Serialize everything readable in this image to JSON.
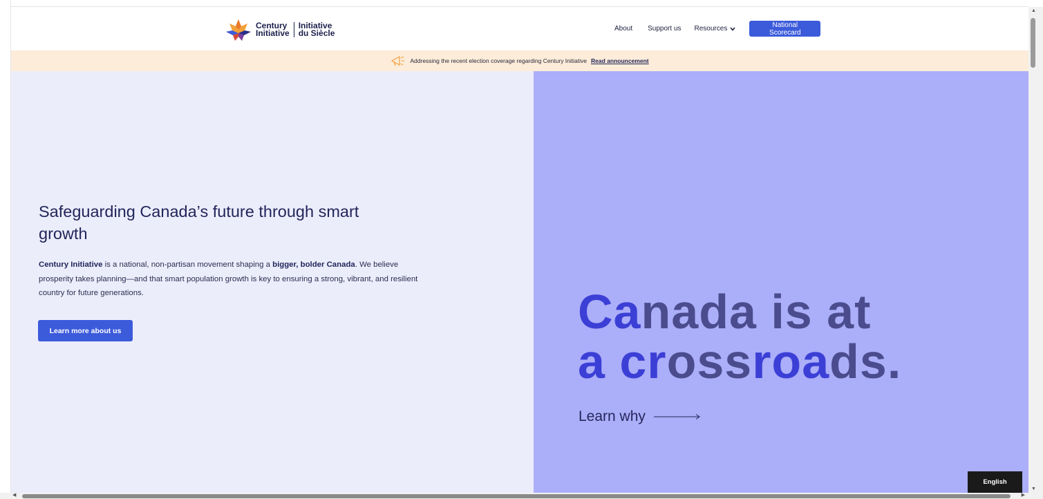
{
  "header": {
    "logo": {
      "en_line1": "Century",
      "en_line2": "Initiative",
      "fr_line1": "Initiative",
      "fr_line2": "du Siècle"
    },
    "nav": {
      "about": "About",
      "support": "Support us",
      "resources": "Resources",
      "scorecard": "National Scorecard"
    }
  },
  "announcement": {
    "text": "Addressing the recent election coverage regarding Century Initiative",
    "link": "Read announcement"
  },
  "hero": {
    "title": "Safeguarding Canada’s future through smart growth",
    "desc_brand": "Century Initiative",
    "desc_part1": " is a national, non-partisan movement shaping a ",
    "desc_bold2": "bigger, bolder Canada",
    "desc_part2": ". We believe prosperity takes planning—and that smart population growth is key to ensuring a strong, vibrant, and resilient country for future generations.",
    "button": "Learn more about us",
    "big_line1_a": "Ca",
    "big_line1_b": "na",
    "big_line1_c": "da is at",
    "big_line2_a": "a cr",
    "big_line2_b": "oss",
    "big_line2_c": "roa",
    "big_line2_d": "ds.",
    "learn_why": "Learn why"
  },
  "language_button": "English",
  "colors": {
    "accent": "#3b5bdb",
    "banner": "#fcecd9",
    "hero_left": "#ecedfb",
    "hero_right": "#abaef8",
    "headline_blue": "#3b3fd6",
    "headline_dark": "#4a4c8e"
  },
  "icons": {
    "logo": "maple-leaf-logo-icon",
    "resources": "chevron-down-icon",
    "announcement": "megaphone-icon",
    "learn_why": "arrow-right-icon"
  }
}
